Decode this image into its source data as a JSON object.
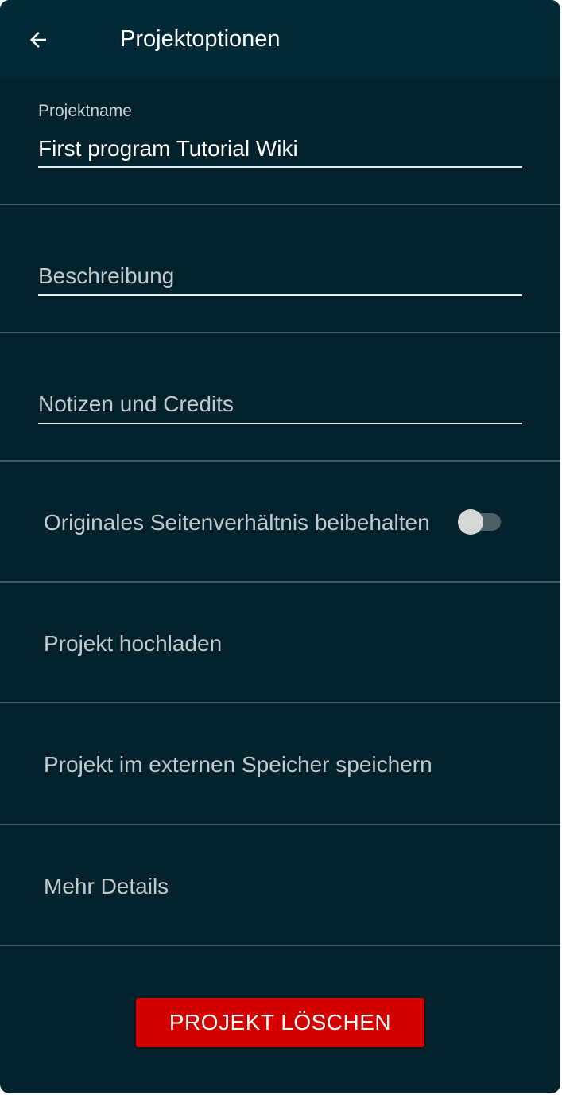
{
  "appbar": {
    "title": "Projektoptionen"
  },
  "fields": {
    "project_name_label": "Projektname",
    "project_name_value": "First program Tutorial Wiki",
    "description_placeholder": "Beschreibung",
    "notes_placeholder": "Notizen und Credits"
  },
  "rows": {
    "aspect_ratio_label": "Originales Seitenverhältnis beibehalten",
    "aspect_ratio_enabled": false,
    "upload_label": "Projekt hochladen",
    "save_external_label": "Projekt im externen Speicher speichern",
    "more_details_label": "Mehr Details"
  },
  "actions": {
    "delete_label": "PROJEKT LÖSCHEN"
  },
  "colors": {
    "background": "#04222c",
    "appbar": "#022936",
    "delete_button": "#d40000"
  }
}
